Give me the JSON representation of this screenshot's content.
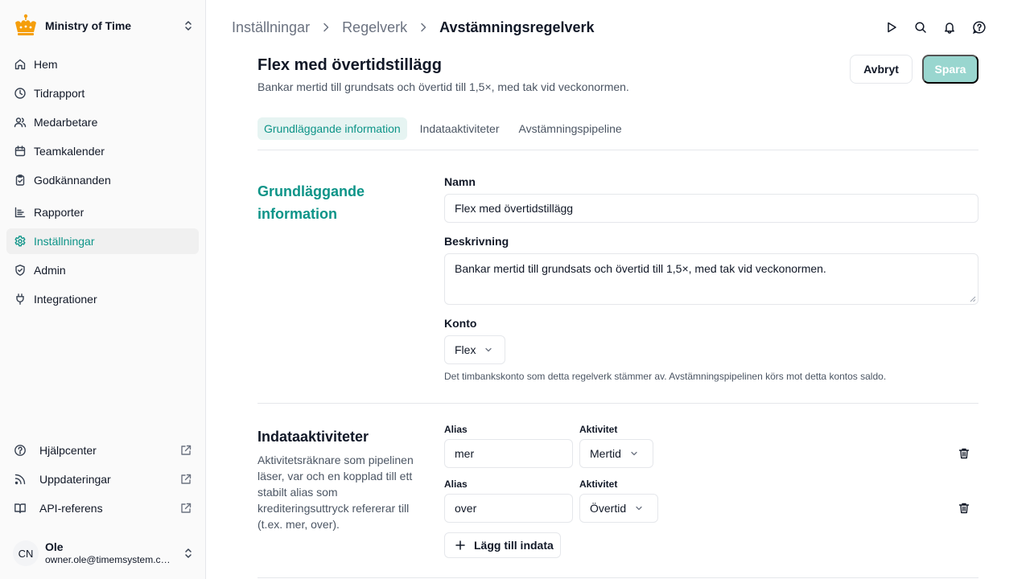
{
  "sidebar": {
    "org_name": "Ministry of Time",
    "nav": [
      {
        "label": "Hem",
        "icon": "home-icon"
      },
      {
        "label": "Tidrapport",
        "icon": "clock-icon"
      },
      {
        "label": "Medarbetare",
        "icon": "users-icon"
      },
      {
        "label": "Teamkalender",
        "icon": "calendar-icon"
      },
      {
        "label": "Godkännanden",
        "icon": "clipboard-check-icon"
      },
      {
        "label": "Rapporter",
        "icon": "chart-icon"
      },
      {
        "label": "Inställningar",
        "icon": "gear-icon",
        "active": true
      },
      {
        "label": "Admin",
        "icon": "shield-check-icon"
      },
      {
        "label": "Integrationer",
        "icon": "plug-icon"
      }
    ],
    "bottom": [
      {
        "label": "Hjälpcenter",
        "icon": "help-circle-icon"
      },
      {
        "label": "Uppdateringar",
        "icon": "rss-icon"
      },
      {
        "label": "API-referens",
        "icon": "book-icon"
      }
    ],
    "user": {
      "initials": "CN",
      "name": "Ole",
      "email": "owner.ole@timemsystem.com"
    }
  },
  "breadcrumb": [
    "Inställningar",
    "Regelverk",
    "Avstämningsregelverk"
  ],
  "header": {
    "title": "Flex med övertidstillägg",
    "subtitle": "Bankar mertid till grundsats och övertid till 1,5×, med tak vid veckonormen.",
    "cancel": "Avbryt",
    "save": "Spara"
  },
  "tabs": [
    "Grundläggande information",
    "Indataaktiviteter",
    "Avstämningspipeline"
  ],
  "basic": {
    "section_title": "Grundläggande information",
    "name_label": "Namn",
    "name_value": "Flex med övertidstillägg",
    "desc_label": "Beskrivning",
    "desc_value": "Bankar mertid till grundsats och övertid till 1,5×, med tak vid veckonormen.",
    "account_label": "Konto",
    "account_value": "Flex",
    "account_hint": "Det timbankskonto som detta regelverk stämmer av. Avstämningspipelinen körs mot detta kontos saldo."
  },
  "inputs": {
    "section_title": "Indataaktiviteter",
    "description": "Aktivitetsräknare som pipelinen läser, var och en kopplad till ett stabilt alias som krediteringsuttryck refererar till (t.ex. mer, over).",
    "alias_label": "Alias",
    "activity_label": "Aktivitet",
    "rows": [
      {
        "alias": "mer",
        "activity": "Mertid"
      },
      {
        "alias": "over",
        "activity": "Övertid"
      }
    ],
    "add_label": "Lägg till indata"
  },
  "colors": {
    "accent": "#0d9488",
    "save_disabled": "#99d6cf"
  }
}
